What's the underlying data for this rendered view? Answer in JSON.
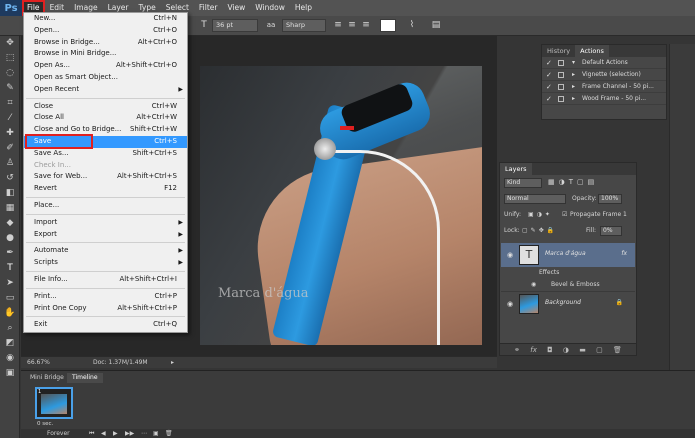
{
  "app": {
    "logo": "Ps"
  },
  "menubar": {
    "items": [
      "File",
      "Edit",
      "Image",
      "Layer",
      "Type",
      "Select",
      "Filter",
      "View",
      "Window",
      "Help"
    ]
  },
  "options": {
    "font_size": "36 pt",
    "aa": "Sharp"
  },
  "file_menu": {
    "items": [
      {
        "label": "New...",
        "shortcut": "Ctrl+N"
      },
      {
        "label": "Open...",
        "shortcut": "Ctrl+O"
      },
      {
        "label": "Browse in Bridge...",
        "shortcut": "Alt+Ctrl+O"
      },
      {
        "label": "Browse in Mini Bridge...",
        "shortcut": ""
      },
      {
        "label": "Open As...",
        "shortcut": "Alt+Shift+Ctrl+O"
      },
      {
        "label": "Open as Smart Object...",
        "shortcut": ""
      },
      {
        "label": "Open Recent",
        "shortcut": ""
      },
      {
        "label": "Close",
        "shortcut": "Ctrl+W"
      },
      {
        "label": "Close All",
        "shortcut": "Alt+Ctrl+W"
      },
      {
        "label": "Close and Go to Bridge...",
        "shortcut": "Shift+Ctrl+W"
      },
      {
        "label": "Save",
        "shortcut": "Ctrl+S"
      },
      {
        "label": "Save As...",
        "shortcut": "Shift+Ctrl+S"
      },
      {
        "label": "Check In...",
        "shortcut": ""
      },
      {
        "label": "Save for Web...",
        "shortcut": "Alt+Shift+Ctrl+S"
      },
      {
        "label": "Revert",
        "shortcut": "F12"
      },
      {
        "label": "Place...",
        "shortcut": ""
      },
      {
        "label": "Import",
        "shortcut": ""
      },
      {
        "label": "Export",
        "shortcut": ""
      },
      {
        "label": "Automate",
        "shortcut": ""
      },
      {
        "label": "Scripts",
        "shortcut": ""
      },
      {
        "label": "File Info...",
        "shortcut": "Alt+Shift+Ctrl+I"
      },
      {
        "label": "Print...",
        "shortcut": "Ctrl+P"
      },
      {
        "label": "Print One Copy",
        "shortcut": "Alt+Shift+Ctrl+P"
      },
      {
        "label": "Exit",
        "shortcut": "Ctrl+Q"
      }
    ]
  },
  "canvas": {
    "watermark": "Marca d'água"
  },
  "status": {
    "zoom": "66.67%",
    "doc": "Doc: 1.37M/1.49M"
  },
  "timeline": {
    "tabs": [
      "Mini Bridge",
      "Timeline"
    ],
    "frame_number": "1",
    "frame_delay": "0 sec.",
    "loop": "Forever"
  },
  "history_panel": {
    "tabs": [
      "History",
      "Actions"
    ],
    "actions": [
      "Default Actions",
      "Vignette (selection)",
      "Frame Channel - 50 pi...",
      "Wood Frame - 50 pi..."
    ]
  },
  "layers_panel": {
    "tab": "Layers",
    "kind": "Kind",
    "blend_mode": "Normal",
    "opacity_label": "Opacity:",
    "opacity": "100%",
    "unify_label": "Unify:",
    "propagate": "Propagate Frame 1",
    "lock_label": "Lock:",
    "fill_label": "Fill:",
    "fill": "0%",
    "layers": [
      {
        "name": "Marca d'água"
      },
      {
        "name": "Background"
      }
    ],
    "effects_label": "Effects",
    "effect": "Bevel & Emboss"
  },
  "colors": {
    "highlight": "#3399ff",
    "annotation_red": "#e02020",
    "accent_blue": "#4aa0e8"
  }
}
